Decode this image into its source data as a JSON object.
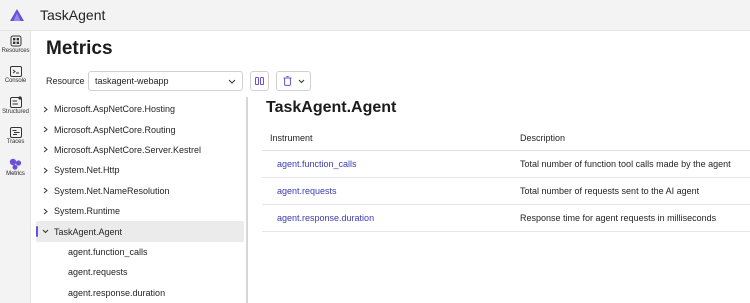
{
  "app": {
    "title": "TaskAgent"
  },
  "rail": [
    {
      "label": "Resources",
      "icon": "resources-icon"
    },
    {
      "label": "Console",
      "icon": "console-icon"
    },
    {
      "label": "Structured",
      "icon": "structured-icon"
    },
    {
      "label": "Traces",
      "icon": "traces-icon"
    },
    {
      "label": "Metrics",
      "icon": "metrics-icon",
      "active": true
    }
  ],
  "page": {
    "title": "Metrics"
  },
  "resource": {
    "label": "Resource",
    "value": "taskagent-webapp"
  },
  "tree": {
    "items": [
      "Microsoft.AspNetCore.Hosting",
      "Microsoft.AspNetCore.Routing",
      "Microsoft.AspNetCore.Server.Kestrel",
      "System.Net.Http",
      "System.Net.NameResolution",
      "System.Runtime",
      "TaskAgent.Agent"
    ],
    "children": [
      "agent.function_calls",
      "agent.requests",
      "agent.response.duration"
    ]
  },
  "detail": {
    "title": "TaskAgent.Agent",
    "headers": {
      "instrument": "Instrument",
      "description": "Description"
    },
    "rows": [
      {
        "instrument": "agent.function_calls",
        "description": "Total number of function tool calls made by the agent"
      },
      {
        "instrument": "agent.requests",
        "description": "Total number of requests sent to the AI agent"
      },
      {
        "instrument": "agent.response.duration",
        "description": "Response time for agent requests in milliseconds"
      }
    ]
  },
  "colors": {
    "accent": "#6b4fd8",
    "link": "#3b3bb5"
  }
}
